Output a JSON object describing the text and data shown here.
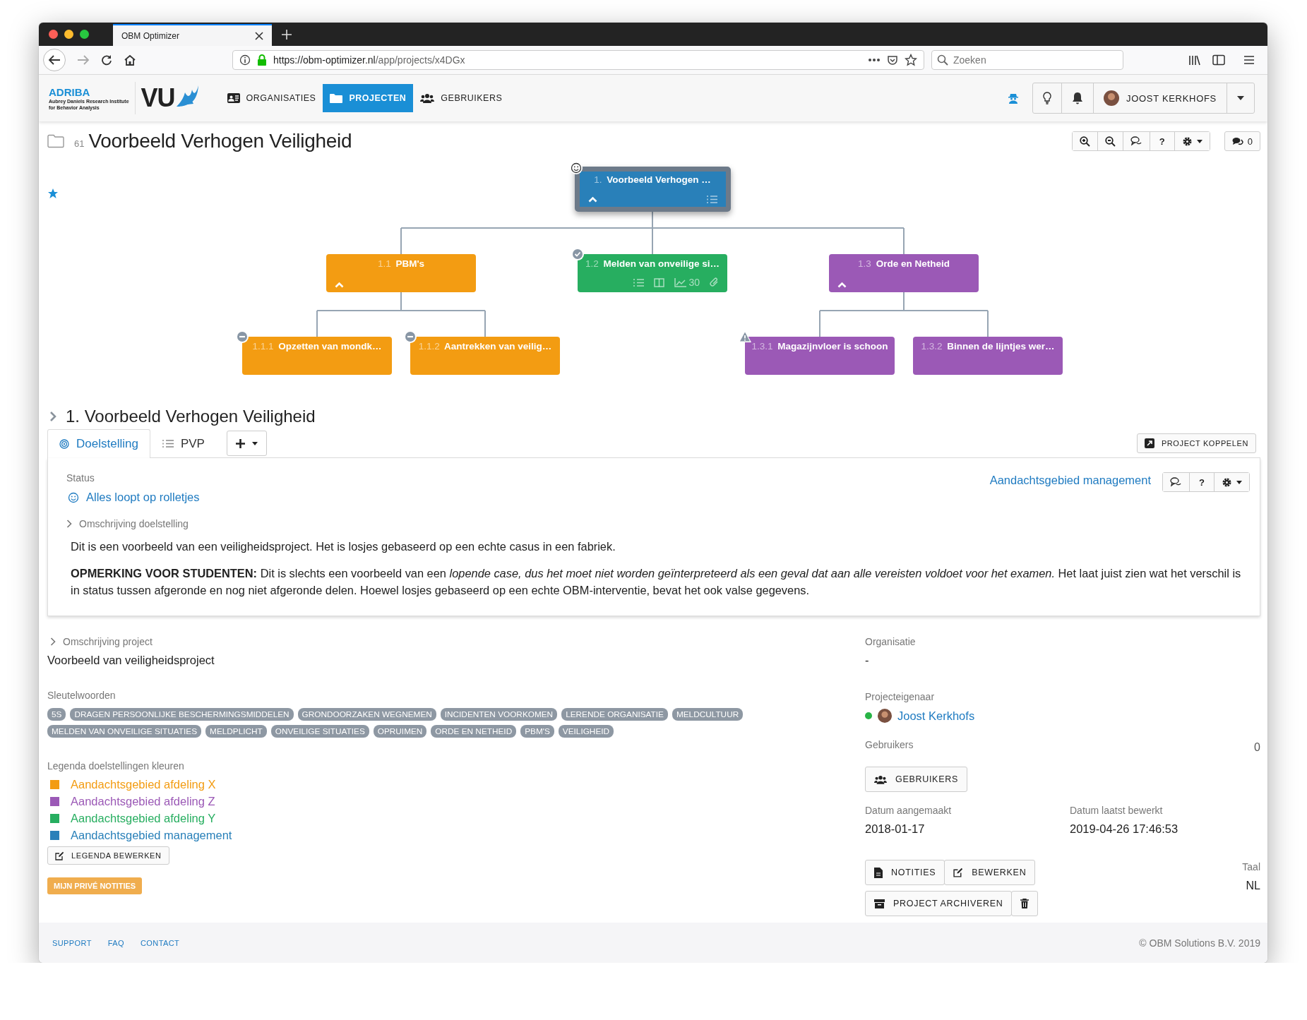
{
  "browser": {
    "tab_title": "OBM Optimizer",
    "url_host": "https://obm-optimizer.nl",
    "url_path": "/app/projects/x4DGx",
    "search_placeholder": "Zoeken"
  },
  "navbar": {
    "brand_name": "ADRIBA",
    "brand_line_1": "Aubrey Daniels Research Institute",
    "brand_line_2": "for Behavior Analysis",
    "logo_text": "VU",
    "items": [
      {
        "label": "ORGANISATIES",
        "selected": false
      },
      {
        "label": "PROJECTEN",
        "selected": true
      },
      {
        "label": "GEBRUIKERS",
        "selected": false
      }
    ],
    "user_name": "JOOST KERKHOFS"
  },
  "project": {
    "number": "61",
    "title": "Voorbeeld Verhogen Veiligheid",
    "starred": true,
    "help_label": "?",
    "comment_count": "0"
  },
  "tree": {
    "nodes": [
      {
        "number": "1.",
        "title": "Voorbeeld Verhogen …",
        "color": "#2980b9",
        "selected": true,
        "kind": "smile",
        "indicators": [
          {
            "kind": "list"
          }
        ],
        "children": [
          {
            "number": "1.1",
            "title": "PBM's",
            "color": "#f39c12",
            "selected": false,
            "kind": "plain",
            "children": [
              {
                "number": "1.1.1",
                "title": "Opzetten van mondk…",
                "color": "#f39c12",
                "selected": false,
                "kind": "minus"
              },
              {
                "number": "1.1.2",
                "title": "Aantrekken van veilig…",
                "color": "#f39c12",
                "selected": false,
                "kind": "minus"
              }
            ]
          },
          {
            "number": "1.2",
            "title": "Melden van onveilige si…",
            "color": "#27ae60",
            "selected": false,
            "kind": "check",
            "indicators": [
              {
                "kind": "list"
              },
              {
                "kind": "columns"
              },
              {
                "kind": "chart",
                "value": "30"
              },
              {
                "kind": "paperclip"
              }
            ]
          },
          {
            "number": "1.3",
            "title": "Orde en Netheid",
            "color": "#9b59b6",
            "selected": false,
            "kind": "plain",
            "children": [
              {
                "number": "1.3.1",
                "title": "Magazijnvloer is schoon",
                "color": "#9b59b6",
                "selected": false,
                "kind": "warning"
              },
              {
                "number": "1.3.2",
                "title": "Binnen de lijntjes wer…",
                "color": "#9b59b6",
                "selected": false,
                "kind": "plain"
              }
            ]
          }
        ]
      }
    ]
  },
  "goal": {
    "number": "1.",
    "title": "Voorbeeld Verhogen Veiligheid",
    "expanded": false,
    "tabs": [
      {
        "label": "Doelstelling",
        "selected": true
      },
      {
        "label": "PVP",
        "selected": false
      }
    ],
    "link_button": "PROJECT KOPPELEN",
    "status_label": "Status",
    "status_value": "Alles loopt op rolletjes",
    "area_link": "Aandachtsgebied management",
    "help_label": "?",
    "description_label": "Omschrijving doelstelling",
    "paragraphs": [
      "Dit is een voorbeeld van een veiligheidsproject. Het is losjes gebaseerd op een echte casus in een fabriek.",
      "**OPMERKING VOOR STUDENTEN:** Dit is slechts een voorbeeld van een *lopende case, dus het moet niet worden geïnterpreteerd als een geval dat aan alle vereisten voldoet voor het examen.* Het laat juist zien wat het verschil is in status tussen afgeronde en nog niet afgeronde delen. Hoewel losjes gebaseerd op een echte OBM-interventie, bevat het ook valse gegevens."
    ]
  },
  "details": {
    "description_label": "Omschrijving project",
    "description": "Voorbeeld van veiligheidsproject",
    "keywords_label": "Sleutelwoorden",
    "keywords": [
      "5S",
      "DRAGEN PERSOONLIJKE BESCHERMINGSMIDDELEN",
      "GRONDOORZAKEN WEGNEMEN",
      "INCIDENTEN VOORKOMEN",
      "LERENDE ORGANISATIE",
      "MELDCULTUUR",
      "MELDEN VAN ONVEILIGE SITUATIES",
      "MELDPLICHT",
      "ONVEILIGE SITUATIES",
      "OPRUIMEN",
      "ORDE EN NETHEID",
      "PBM'S",
      "VEILIGHEID"
    ],
    "legend_label": "Legenda doelstellingen kleuren",
    "legend": [
      {
        "label": "Aandachtsgebied afdeling X",
        "color": "#f39c12"
      },
      {
        "label": "Aandachtsgebied afdeling Z",
        "color": "#9b59b6"
      },
      {
        "label": "Aandachtsgebied afdeling Y",
        "color": "#27ae60"
      },
      {
        "label": "Aandachtsgebied management",
        "color": "#2980b9"
      }
    ],
    "legend_button": "LEGENDA BEWERKEN",
    "notes_button": "MIJN PRIVÉ NOTITIES",
    "organisation_label": "Organisatie",
    "organisation": "-",
    "owner_label": "Projecteigenaar",
    "owner": "Joost Kerkhofs",
    "owner_online": true,
    "users_label": "Gebruikers",
    "users_count": "0",
    "users_button": "GEBRUIKERS",
    "created_label": "Datum aangemaakt",
    "created": "2018-01-17",
    "edited_label": "Datum laatst bewerkt",
    "edited": "2019-04-26 17:46:53",
    "notes_action": "NOTITIES",
    "edit_action": "BEWERKEN",
    "archive_action": "PROJECT ARCHIVEREN",
    "language_label": "Taal",
    "language": "NL"
  },
  "footer": {
    "links": [
      "SUPPORT",
      "FAQ",
      "CONTACT"
    ],
    "copyright": "© OBM Solutions B.V. 2019"
  }
}
